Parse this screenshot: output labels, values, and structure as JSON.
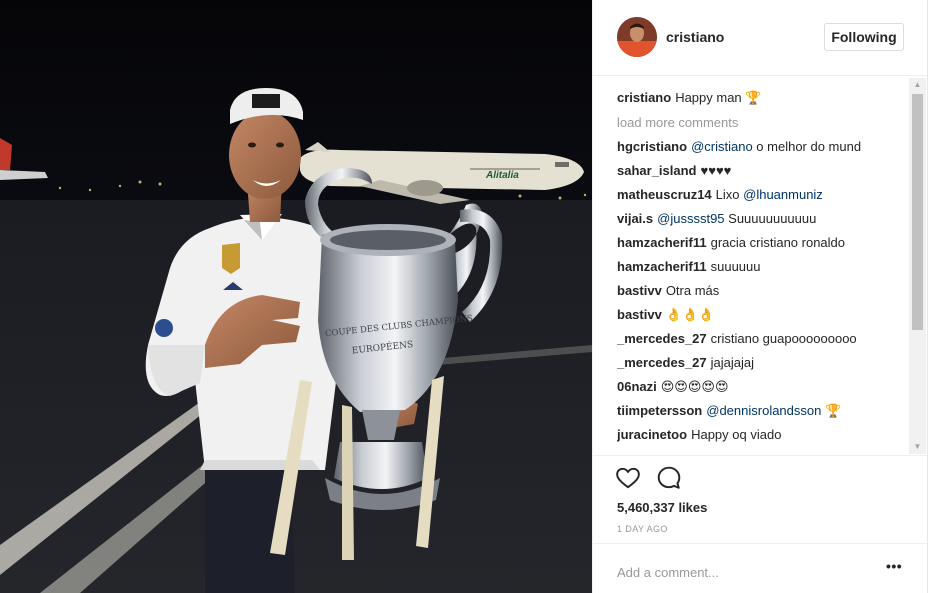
{
  "post": {
    "username": "cristiano",
    "follow_label": "Following",
    "likes": "5,460,337 likes",
    "time": "1 DAY AGO",
    "add_comment_placeholder": "Add a comment...",
    "more_label": "•••",
    "caption": {
      "user": "cristiano",
      "text": "Happy man 🏆"
    },
    "load_more": "load more comments",
    "photo_text": {
      "airline": "Alitalia",
      "trophy_engraving_1": "COUPE DES CLUBS CHAMPIONS",
      "trophy_engraving_2": "EUROPÉENS"
    }
  },
  "comments": [
    {
      "user": "hgcristiano",
      "mention": "@cristiano",
      "text": " o melhor do mund"
    },
    {
      "user": "sahar_island",
      "mention": "",
      "text": "♥♥♥♥"
    },
    {
      "user": "matheuscruz14",
      "text": "Lixo ",
      "mention": "@lhuanmuniz"
    },
    {
      "user": "vijai.s",
      "mention": "@jusssst95",
      "text": " Suuuuuuuuuuu"
    },
    {
      "user": "hamzacherif11",
      "mention": "",
      "text": "gracia cristiano ronaldo"
    },
    {
      "user": "hamzacherif11",
      "mention": "",
      "text": "suuuuuu"
    },
    {
      "user": "bastivv",
      "mention": "",
      "text": "Otra más"
    },
    {
      "user": "bastivv",
      "mention": "",
      "text": "👌👌👌"
    },
    {
      "user": "_mercedes_27",
      "mention": "",
      "text": "cristiano guapooooooooo"
    },
    {
      "user": "_mercedes_27",
      "mention": "",
      "text": "jajajajaj"
    },
    {
      "user": "06nazi",
      "mention": "",
      "text": "😍😍😍😍😍"
    },
    {
      "user": "tiimpetersson",
      "mention": "@dennisrolandsson",
      "text": " 🏆"
    },
    {
      "user": "juracinetoo",
      "mention": "",
      "text": "Happy oq viado"
    }
  ],
  "colors": {
    "mention": "#003569",
    "muted": "#999999",
    "text": "#262626",
    "border": "#dbdbdb"
  },
  "icons": [
    "heart-icon",
    "comment-icon",
    "more-options-icon",
    "scroll-up-arrow-icon",
    "scroll-down-arrow-icon"
  ]
}
